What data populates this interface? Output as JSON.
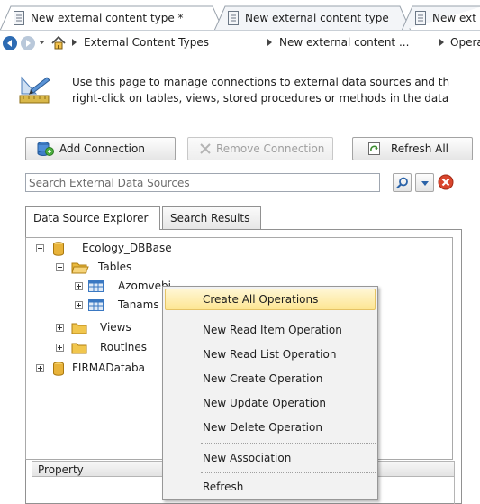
{
  "document_tabs": [
    {
      "label": "New external content type *"
    },
    {
      "label": "New external content type"
    },
    {
      "label": "New ext"
    }
  ],
  "breadcrumb": {
    "items": [
      "External Content Types",
      "New external content ...",
      "Opera"
    ]
  },
  "info": {
    "line1": "Use this page to manage connections to external data sources and th",
    "line2": "right-click on tables, views, stored procedures or methods in the data"
  },
  "toolbar": {
    "add_connection": "Add Connection",
    "remove_connection": "Remove Connection",
    "refresh_all": "Refresh All"
  },
  "search": {
    "placeholder": "Search External Data Sources"
  },
  "panel_tabs": [
    {
      "label": "Data Source Explorer",
      "active": true
    },
    {
      "label": "Search Results",
      "active": false
    }
  ],
  "tree": {
    "root1": "Ecology_DBBase",
    "tables": "Tables",
    "table1": "Azomvebi",
    "table2": "Tanams",
    "views": "Views",
    "routines": "Routines",
    "root2": "FIRMADataba"
  },
  "property_grid": {
    "header": "Property"
  },
  "context_menu": {
    "items": [
      "Create All Operations",
      "New Read Item Operation",
      "New Read List Operation",
      "New Create Operation",
      "New Update Operation",
      "New Delete Operation",
      "New Association",
      "Refresh"
    ],
    "highlighted_index": 0
  },
  "colors": {
    "menu_highlight": "#fde693",
    "database_icon": "#e8b33a",
    "folder_icon": "#f1c64d",
    "table_icon": "#3a78c2",
    "cancel_icon": "#d9452c"
  }
}
